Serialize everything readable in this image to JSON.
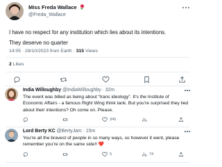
{
  "tweet": {
    "author_name": "Miss Freda Wallace",
    "author_handle": "@Freda_Wallace",
    "text_line1": "I have no respect for any institution which lies about its intentions.",
    "text_line2": "They deserve no quarter",
    "timestamp": "14:05 · 28/10/2023 from Earth · ",
    "views_count": "315",
    "views_label": " Views",
    "likes_count": "2",
    "likes_label": " Likes"
  },
  "replies": [
    {
      "name": "India Willoughby",
      "handle": "@IndiaWilloughby · 32m",
      "text": "The event was billed as being about “trans ideology”. It’s the Institute of Economic Affairs - a famous Right Wing think tank. But you’re surprised they lied about their intentions? Oh come on. Please.",
      "counts": {
        "replies": "",
        "retweets": "",
        "likes": "345",
        "views": ""
      }
    },
    {
      "name": "Lord Berty KC",
      "handle": "@BertyJam · 15m",
      "text": "You’re all the bravest of people in so many ways, so however it went, please remember you’re on the same side!!",
      "heart_emoji": "❤️",
      "counts": {
        "replies": "",
        "retweets": "",
        "likes": "5",
        "views": "74"
      }
    }
  ],
  "icons": [
    "verified-rose-badge",
    "reply-icon",
    "retweet-icon",
    "like-icon",
    "bookmark-icon",
    "share-icon",
    "views-icon",
    "more-icon"
  ],
  "colors": {
    "text": "#0f1419",
    "secondary": "#536471",
    "divider": "#e6ecf0",
    "heart": "#e0245e"
  }
}
